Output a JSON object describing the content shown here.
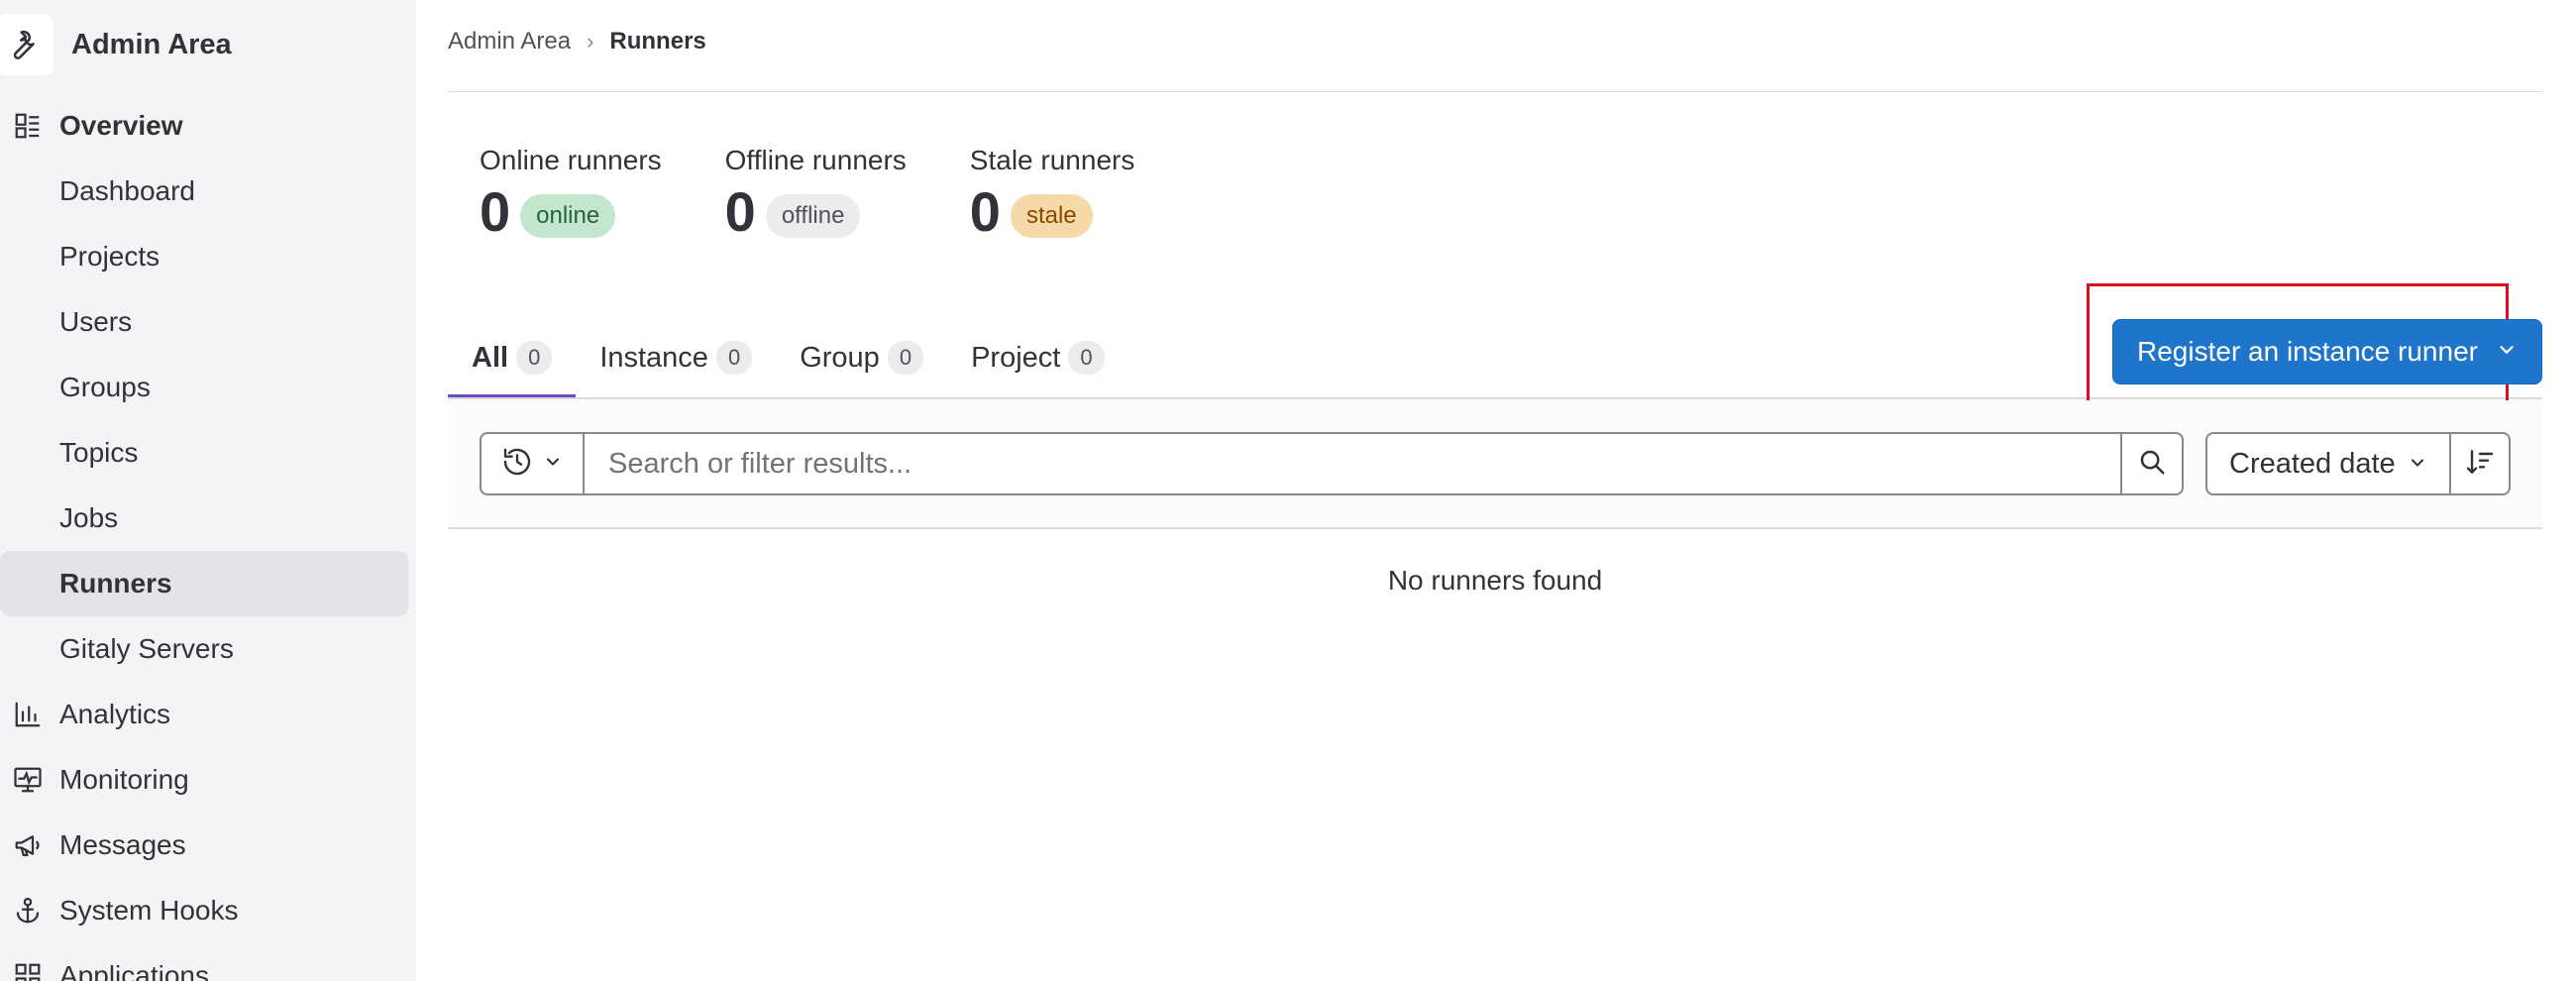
{
  "sidebar": {
    "title": "Admin Area",
    "items": [
      {
        "label": "Overview",
        "icon": "overview-icon",
        "type": "section"
      },
      {
        "label": "Dashboard",
        "type": "sub"
      },
      {
        "label": "Projects",
        "type": "sub"
      },
      {
        "label": "Users",
        "type": "sub"
      },
      {
        "label": "Groups",
        "type": "sub"
      },
      {
        "label": "Topics",
        "type": "sub"
      },
      {
        "label": "Jobs",
        "type": "sub"
      },
      {
        "label": "Runners",
        "type": "sub",
        "active": true
      },
      {
        "label": "Gitaly Servers",
        "type": "sub"
      },
      {
        "label": "Analytics",
        "icon": "chart-icon",
        "type": "section"
      },
      {
        "label": "Monitoring",
        "icon": "monitor-icon",
        "type": "section"
      },
      {
        "label": "Messages",
        "icon": "megaphone-icon",
        "type": "section"
      },
      {
        "label": "System Hooks",
        "icon": "anchor-icon",
        "type": "section"
      },
      {
        "label": "Applications",
        "icon": "applications-icon",
        "type": "section"
      }
    ]
  },
  "breadcrumb": {
    "parent": "Admin Area",
    "separator": "›",
    "current": "Runners"
  },
  "stats": [
    {
      "label": "Online runners",
      "count": "0",
      "badge": "online",
      "color": "#c3e6cd"
    },
    {
      "label": "Offline runners",
      "count": "0",
      "badge": "offline",
      "color": "#ececef"
    },
    {
      "label": "Stale runners",
      "count": "0",
      "badge": "stale",
      "color": "#f5d9a8"
    }
  ],
  "tabs": [
    {
      "label": "All",
      "count": "0",
      "active": true
    },
    {
      "label": "Instance",
      "count": "0"
    },
    {
      "label": "Group",
      "count": "0"
    },
    {
      "label": "Project",
      "count": "0"
    }
  ],
  "register_button": {
    "label": "Register an instance runner",
    "color": "#1f75cb"
  },
  "search": {
    "placeholder": "Search or filter results...",
    "value": ""
  },
  "sort": {
    "label": "Created date"
  },
  "empty_state": "No runners found",
  "accent_colors": {
    "tab_underline": "#6e49cb",
    "highlight_box": "#dd0e1b"
  }
}
